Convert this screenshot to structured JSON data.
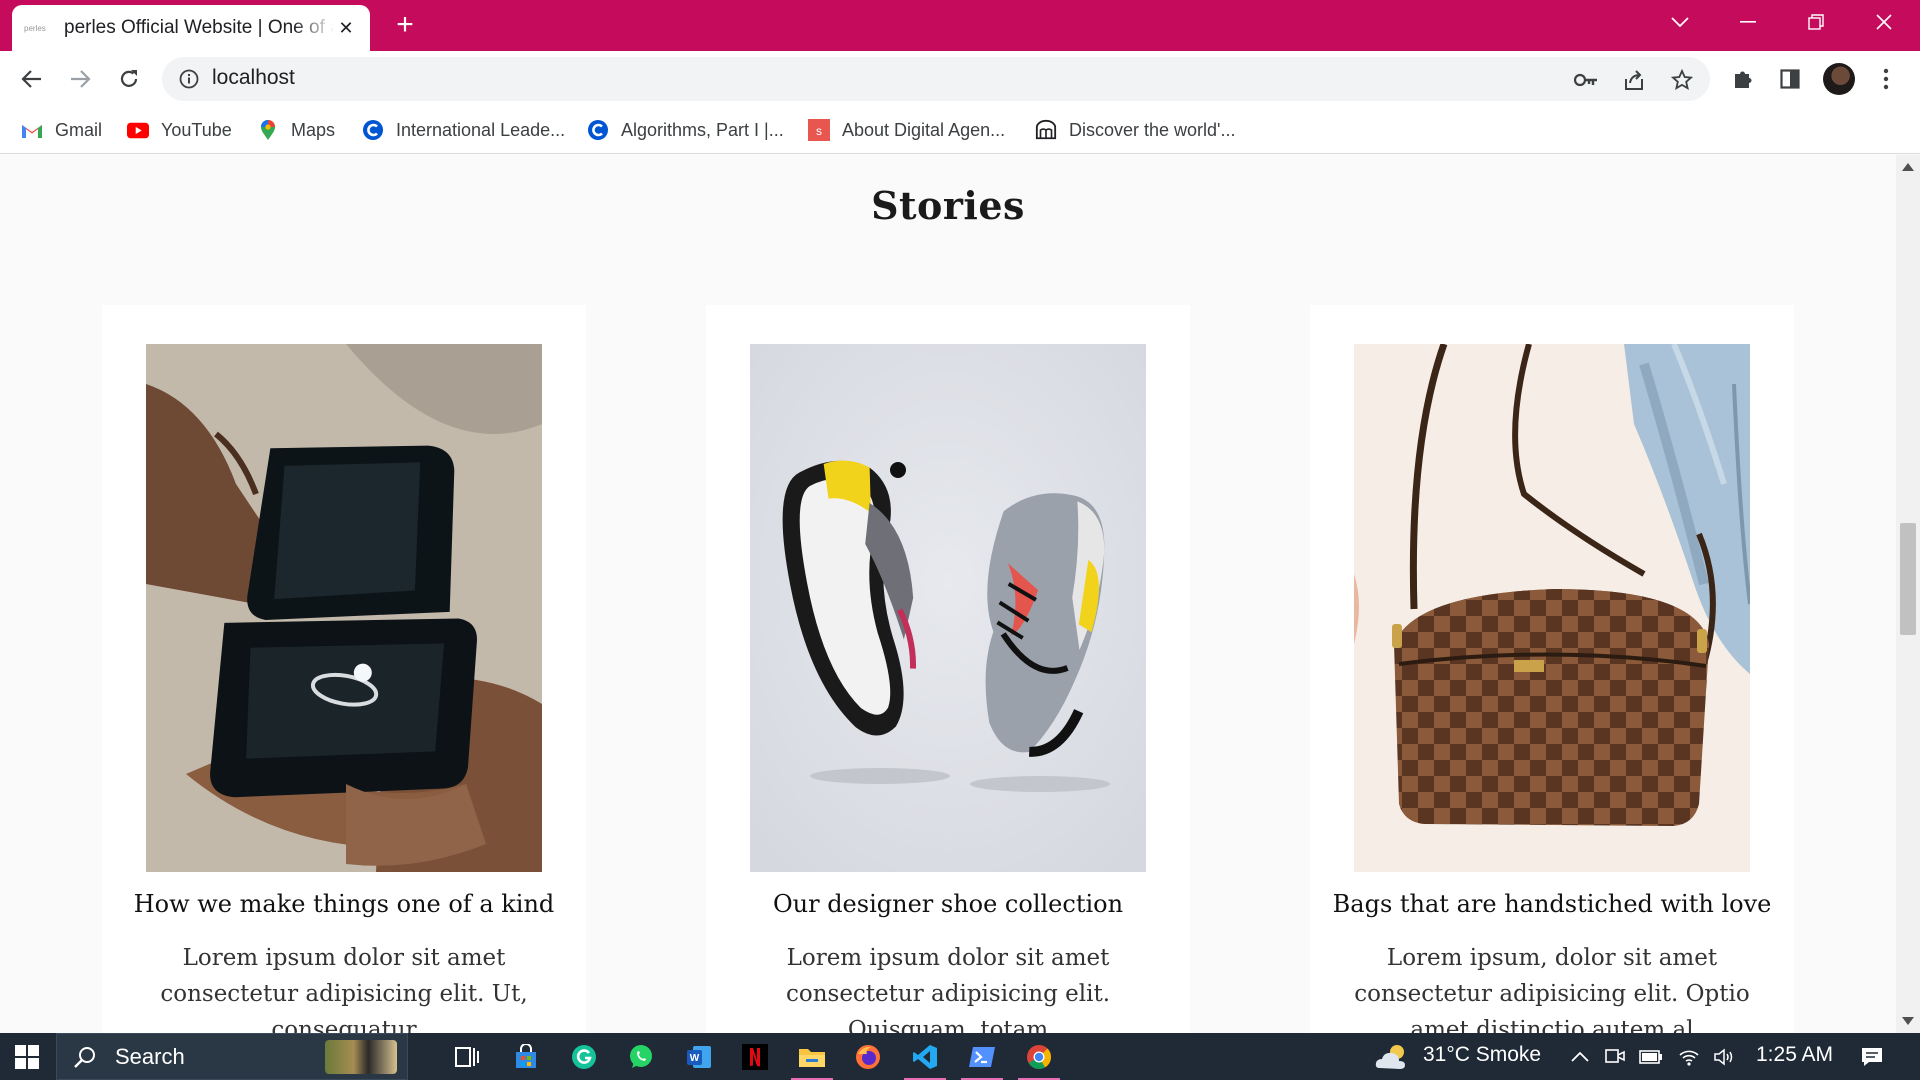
{
  "browser": {
    "tab": {
      "favicon_text": "perles",
      "title": "perles Official Website | One of a kind"
    },
    "address": "localhost",
    "bookmarks": [
      {
        "label": "Gmail",
        "icon": "gmail-icon"
      },
      {
        "label": "YouTube",
        "icon": "youtube-icon"
      },
      {
        "label": "Maps",
        "icon": "maps-icon"
      },
      {
        "label": "International Leade...",
        "icon": "c-logo-icon"
      },
      {
        "label": "Algorithms, Part I |...",
        "icon": "c-logo-icon"
      },
      {
        "label": "About Digital Agen...",
        "icon": "s-logo-icon"
      },
      {
        "label": "Discover the world'...",
        "icon": "globe-book-icon"
      }
    ],
    "colors": {
      "tab_strip": "#c50b5c",
      "toolbar": "#ffffff"
    }
  },
  "page": {
    "heading": "Stories",
    "cards": [
      {
        "title": "How we make things one of a kind",
        "body": "Lorem ipsum dolor sit amet consectetur adipisicing elit. Ut, consequatur",
        "image": "ring-box-photo"
      },
      {
        "title": "Our designer shoe collection",
        "body": "Lorem ipsum dolor sit amet consectetur adipisicing elit. Quisquam, totam",
        "image": "sneakers-photo"
      },
      {
        "title": "Bags that are handstiched with love",
        "body": "Lorem ipsum, dolor sit amet consectetur adipisicing elit. Optio amet distinctio autem al",
        "image": "handbag-photo"
      }
    ]
  },
  "taskbar": {
    "search_label": "Search",
    "weather": "31°C  Smoke",
    "time": "1:25 AM",
    "apps": [
      "task-view-icon",
      "store-icon",
      "grammarly-icon",
      "whatsapp-icon",
      "word-icon",
      "netflix-icon",
      "file-explorer-icon",
      "firefox-icon",
      "vscode-icon",
      "powershell-icon",
      "chrome-icon"
    ]
  }
}
